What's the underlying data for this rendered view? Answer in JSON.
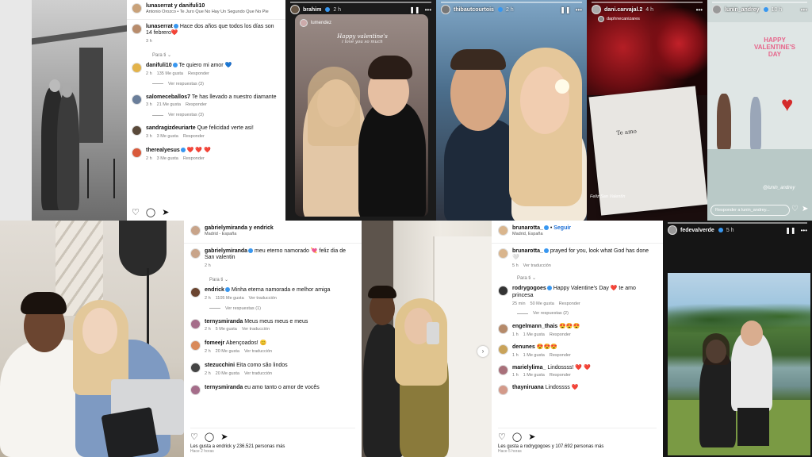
{
  "tile1": {
    "header_users": "lunaserrat y danifuli10",
    "header_song": "Antonio Orozco • Te Juro Que No Hay Un Segundo Que No Pie",
    "caption_user": "lunaserrat",
    "caption_text": "Hace dos años que todos los días son 14 febrero❤️",
    "caption_time": "3 h",
    "for_you": "Para ti",
    "comments": [
      {
        "user": "danifuli10",
        "text": "Te quiero mi amor 💙",
        "time": "2 h",
        "likes": "135 Me gusta",
        "reply": "Responder",
        "more": "Ver respuestas (3)"
      },
      {
        "user": "salomeceballos7",
        "text": "Te has llevado a nuestro diamante",
        "time": "3 h",
        "likes": "21 Me gusta",
        "reply": "Responder",
        "more": "Ver respuestas (3)"
      },
      {
        "user": "sandragizdeuriarte",
        "text": "Que felicidad verte asi!",
        "time": "3 h",
        "likes": "3 Me gusta",
        "reply": "Responder",
        "more": ""
      },
      {
        "user": "therealyesus",
        "text": "❤️ ❤️ ❤️",
        "time": "2 h",
        "likes": "3 Me gusta",
        "reply": "Responder",
        "more": ""
      }
    ],
    "icons": [
      "heart-icon",
      "comment-icon",
      "share-icon"
    ]
  },
  "story1": {
    "user": "brahim",
    "time": "2 h",
    "inner_user": "lumendez",
    "text1": "Happy valentine's",
    "text2": "i love you so much"
  },
  "story2": {
    "user": "thibautcourtois",
    "time": "2 h"
  },
  "story3": {
    "user": "dani.carvajal.2",
    "time": "4 h",
    "tag": "daphnecanizares",
    "card_text": "Te amo",
    "bottom_text": "Feliz San Valentín"
  },
  "story4": {
    "user": "lunin_andrey",
    "time": "10 h",
    "sign_line1": "HAPPY",
    "sign_line2": "VALENTINE'S",
    "sign_line3": "DAY",
    "tag": "@lunin_andrey",
    "reply_placeholder": "Responder a lunin_andrey..."
  },
  "tile2": {
    "header_users": "gabrielymiranda y endrick",
    "location": "Madrid - España",
    "caption_user": "gabrielymiranda",
    "caption_text": "meu eterno namorado 💘 feliz dia de San valentin",
    "caption_time": "2 h",
    "for_you": "Para ti",
    "comments": [
      {
        "user": "endrick",
        "text": "Minha eterna namorada e melhor amiga",
        "time": "2 h",
        "likes": "1105 Me gusta",
        "reply": "Ver traducción",
        "more": "Ver respuestas (1)"
      },
      {
        "user": "ternysmiranda",
        "text": "Meus meus meus e meus",
        "time": "2 h",
        "likes": "5 Me gusta",
        "reply": "Ver traducción",
        "more": ""
      },
      {
        "user": "fomeejr",
        "text": "Abençoados! 😊",
        "time": "2 h",
        "likes": "20 Me gusta",
        "reply": "Ver traducción",
        "more": ""
      },
      {
        "user": "stezucchini",
        "text": "Eita como são lindos",
        "time": "2 h",
        "likes": "20 Me gusta",
        "reply": "Ver traducción",
        "more": ""
      },
      {
        "user": "ternysmiranda",
        "text": "eu amo tanto o amor de vocês",
        "time": "",
        "likes": "",
        "reply": "",
        "more": ""
      }
    ],
    "likes_text": "Les gusta a endrick y 236.521 personas más",
    "posted": "Hace 2 horas"
  },
  "tile3": {
    "header_user": "brunarotta_",
    "follow": "Seguir",
    "location": "Madrid, España",
    "caption_user": "brunarotta_",
    "caption_text": "prayed for you, look what God has done 🤍",
    "caption_time": "5 h",
    "caption_translate": "Ver traducción",
    "for_you": "Para ti",
    "comments": [
      {
        "user": "rodrygogoes",
        "text": "Happy Valentine's Day ❤️ te amo princesa",
        "time": "25 min",
        "likes": "50 Me gusta",
        "reply": "Responder",
        "more": "Ver respuestas (2)"
      },
      {
        "user": "engelmann_thais",
        "text": "😍😍😍",
        "time": "1 h",
        "likes": "1 Me gusta",
        "reply": "Responder",
        "more": ""
      },
      {
        "user": "denunes",
        "text": "😍😍😍",
        "time": "1 h",
        "likes": "1 Me gusta",
        "reply": "Responder",
        "more": ""
      },
      {
        "user": "marielylima_",
        "text": "Lindossss! ❤️ ❤️",
        "time": "1 h",
        "likes": "1 Me gusta",
        "reply": "Responder",
        "more": ""
      },
      {
        "user": "thayniruana",
        "text": "Lindossss ❤️",
        "time": "",
        "likes": "",
        "reply": "",
        "more": ""
      }
    ],
    "likes_text": "Les gusta a rodrygogoes y 107.692 personas más",
    "posted": "Hace 5 horas"
  },
  "story5": {
    "user": "fedevalverde",
    "time": "5 h"
  }
}
